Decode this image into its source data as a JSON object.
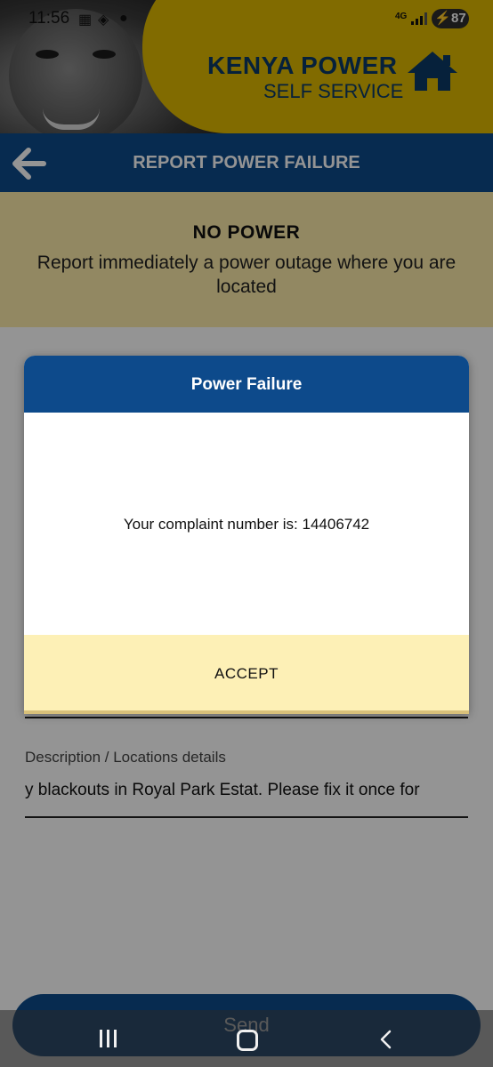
{
  "status_bar": {
    "time": "11:56",
    "network": "4G",
    "battery": "87",
    "icons": [
      "calendar-icon",
      "stack-icon",
      "chat-icon",
      "wifi-icon",
      "signal-icon",
      "battery-charging-icon"
    ]
  },
  "header": {
    "brand_name": "KENYA POWER",
    "brand_sub": "SELF SERVICE",
    "brand_color": "#dfb800",
    "brand_text_color": "#0b3a66"
  },
  "titlebar": {
    "title": "REPORT POWER FAILURE",
    "color": "#0d4a8b"
  },
  "banner": {
    "title": "NO POWER",
    "text": "Report immediately a power outage where you are located",
    "color": "#fbeaa9"
  },
  "form": {
    "description_label": "Description / Locations details",
    "description_value": "y blackouts in Royal Park Estat. Please fix it once for",
    "send_label": "Send"
  },
  "dialog": {
    "title": "Power Failure",
    "message": "Your complaint number is: 14406742",
    "accept_label": "ACCEPT",
    "footer_color": "#fdf0b6"
  },
  "navbar": {
    "icons": [
      "recent-apps-icon",
      "home-icon",
      "back-icon"
    ]
  }
}
